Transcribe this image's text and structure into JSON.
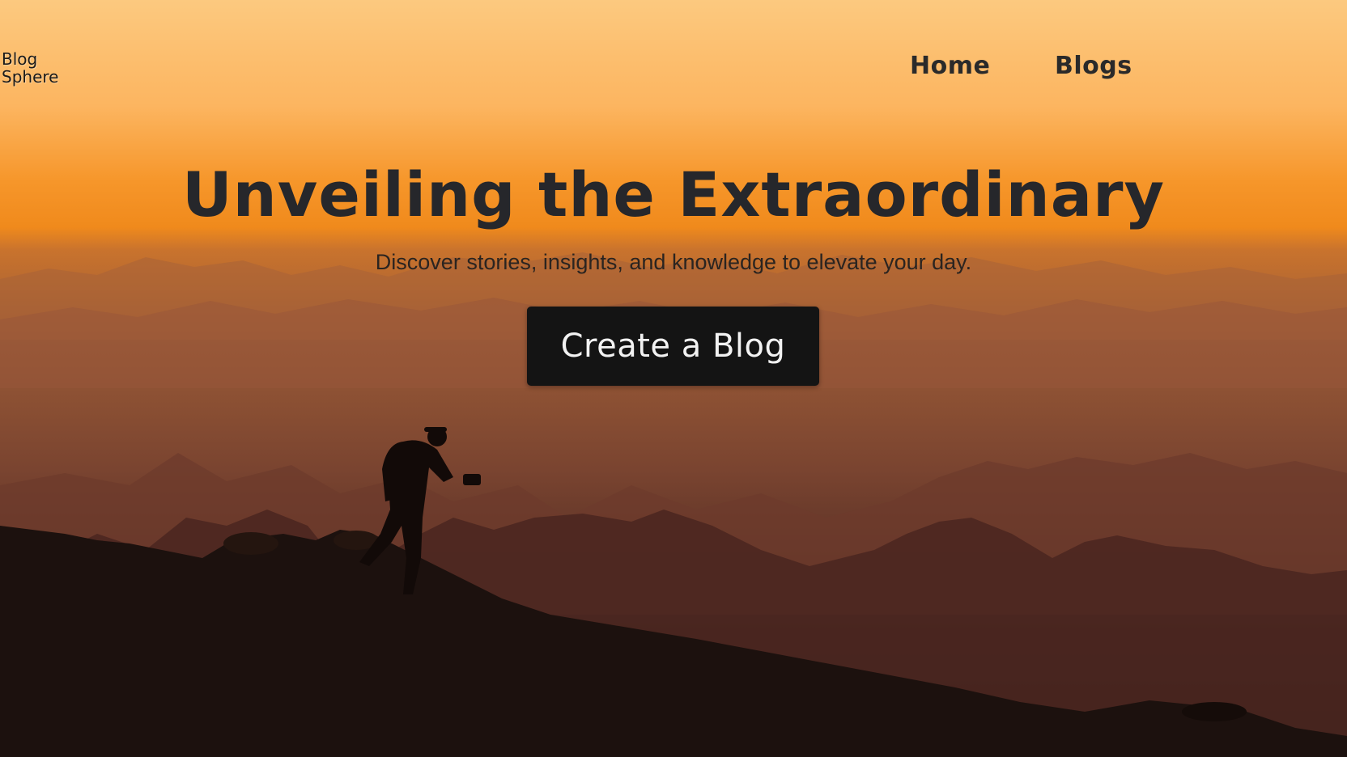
{
  "brand": {
    "line1": "Blog",
    "line2": "Sphere"
  },
  "nav": {
    "items": [
      {
        "label": "Home"
      },
      {
        "label": "Blogs"
      }
    ]
  },
  "hero": {
    "title": "Unveiling the Extraordinary",
    "subtitle": "Discover stories, insights, and knowledge to elevate your day.",
    "cta_label": "Create a Blog"
  },
  "colors": {
    "sky_top": "#fcc77f",
    "sky_horizon": "#f08a1c",
    "haze": "#9a5a34",
    "foreground": "#1a0f0c",
    "button_bg": "#141414",
    "text_dark": "#26272b"
  }
}
